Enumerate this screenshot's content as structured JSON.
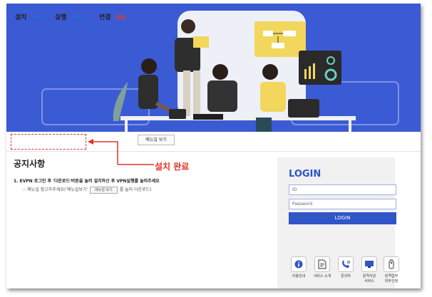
{
  "status": {
    "install_label": "설치",
    "install_value": "Yes",
    "run_label": "실행",
    "run_value": "Yes",
    "connect_label": "연결",
    "connect_value": "No",
    "manual_button": "메뉴얼 보기"
  },
  "callout": {
    "label": "설치 완료"
  },
  "notice": {
    "title": "공지사항",
    "line1": "1. EVPN 로그인 후 '다운로드'버튼을 눌러 설치하신 후 VPN실행를 눌러주세요",
    "line2_prefix": "☞ 메뉴얼 참고하주세요('메뉴얼보기'",
    "line2_button": "메뉴얼 보기",
    "line2_suffix": "를 눌러 다운로드)"
  },
  "login": {
    "title": "LOGIN",
    "id_placeholder": "ID",
    "password_placeholder": "Password",
    "button": "LOGIN"
  },
  "services": [
    {
      "label": "이용안내",
      "icon": "info-icon"
    },
    {
      "label": "서비스 소개",
      "icon": "document-icon"
    },
    {
      "label": "문의처",
      "icon": "phone-icon"
    },
    {
      "label": "원격지원\n서비스",
      "icon": "monitor-icon"
    },
    {
      "label": "원격업무\n외부신청",
      "icon": "remote-icon"
    }
  ],
  "colors": {
    "hero": "#3b5bd4",
    "accent": "#2a56c6",
    "alert": "#e0332a",
    "yes": "#1f6fd6"
  }
}
